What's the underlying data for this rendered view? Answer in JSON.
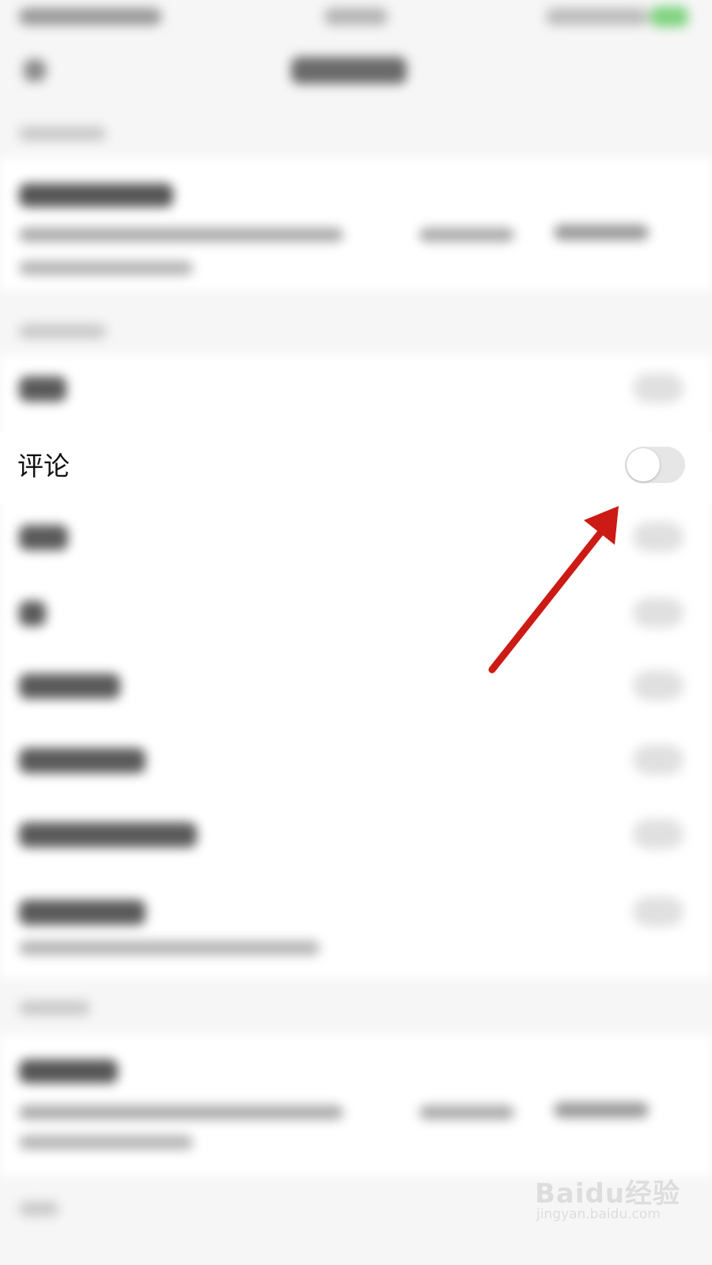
{
  "comment_setting": {
    "label": "评论",
    "toggle_on": false,
    "toggle_track_color": "#e6e6e6"
  },
  "annotation": {
    "arrow_color": "#cc1a14"
  },
  "watermark": {
    "brand": "Baidu经验",
    "url": "jingyan.baidu.com"
  }
}
